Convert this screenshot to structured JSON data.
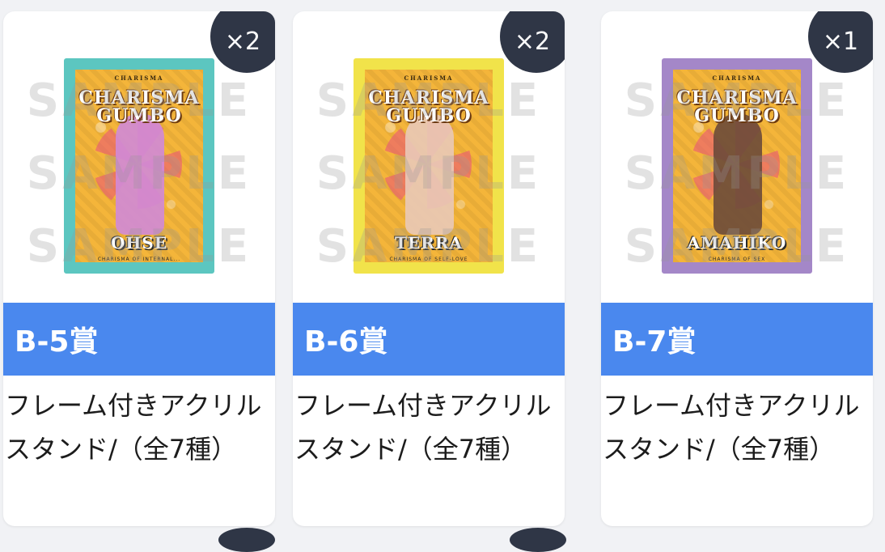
{
  "sample_watermark": "SAMPLE",
  "cards": [
    {
      "badge": "×2",
      "rank": "B-5賞",
      "description": "フレーム付きアクリルスタンド/（全7種）",
      "product": {
        "logo_top": "CHARISMA",
        "logo_line1": "CHARISMA",
        "logo_line2": "GUMBO",
        "name": "OHSE",
        "sub": "CHARISMA OF INTERNAL...",
        "frame_color": "#5cc6c0",
        "figure_color": "#d08ad8"
      }
    },
    {
      "badge": "×2",
      "rank": "B-6賞",
      "description": "フレーム付きアクリルスタンド/（全7種）",
      "product": {
        "logo_top": "CHARISMA",
        "logo_line1": "CHARISMA",
        "logo_line2": "GUMBO",
        "name": "TERRA",
        "sub": "CHARISMA OF SELF-LOVE",
        "frame_color": "#f1e34a",
        "figure_color": "#e9c9b8"
      }
    },
    {
      "badge": "×1",
      "rank": "B-7賞",
      "description": "フレーム付きアクリルスタンド/（全7種）",
      "product": {
        "logo_top": "CHARISMA",
        "logo_line1": "CHARISMA",
        "logo_line2": "GUMBO",
        "name": "AMAHIKO",
        "sub": "CHARISMA OF SEX",
        "frame_color": "#a487c8",
        "figure_color": "#6b4a3a"
      }
    }
  ]
}
